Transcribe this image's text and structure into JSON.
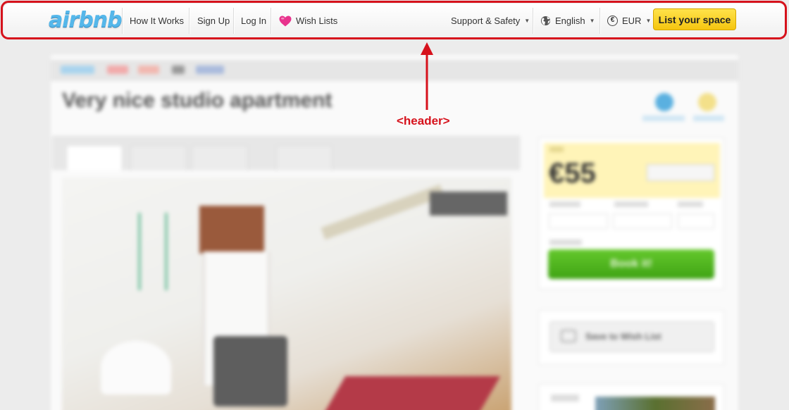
{
  "header": {
    "logo": "airbnb",
    "nav": {
      "how_it_works": "How It Works",
      "sign_up": "Sign Up",
      "log_in": "Log In",
      "wish_lists": "Wish Lists",
      "support": "Support & Safety",
      "language": "English",
      "currency": "EUR",
      "list_space": "List your space"
    },
    "icons": {
      "wish_lists": "heart-icon",
      "language": "globe-icon",
      "currency": "euro-icon"
    },
    "colors": {
      "logo": "#55b7ea",
      "heart": "#e8338d",
      "list_space_button": "#f5c510"
    }
  },
  "annotation": {
    "label": "<header>",
    "color": "#d6121c"
  },
  "listing": {
    "title": "Very nice studio apartment",
    "price": "€55",
    "book_button": "Book it!",
    "wish_button": "Save to Wish List"
  }
}
